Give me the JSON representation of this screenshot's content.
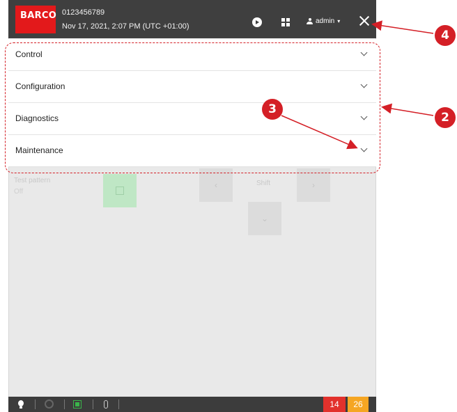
{
  "topbar": {
    "logo_text": "BARCO",
    "serial": "0123456789",
    "datetime": "Nov 17, 2021, 2:07 PM (UTC +01:00)",
    "user": "admin",
    "icons": [
      "play-icon",
      "layout-icon",
      "user-icon",
      "close-icon"
    ]
  },
  "accordion": {
    "items": [
      {
        "label": "Control"
      },
      {
        "label": "Configuration"
      },
      {
        "label": "Diagnostics"
      },
      {
        "label": "Maintenance"
      }
    ]
  },
  "background": {
    "test_pattern_label": "Test pattern",
    "test_pattern_value": "Off",
    "left_arrow": "‹",
    "right_arrow": "›",
    "down_arrow": "⌄",
    "shift_label": "Shift"
  },
  "statusbar": {
    "badge_red": "14",
    "badge_orange": "26",
    "colors": {
      "red": "#e2312c",
      "orange": "#f5a623",
      "green": "#3ab54a"
    }
  },
  "callouts": {
    "marker_2": "2",
    "marker_3": "3",
    "marker_4": "4",
    "color": "#d41f26"
  }
}
